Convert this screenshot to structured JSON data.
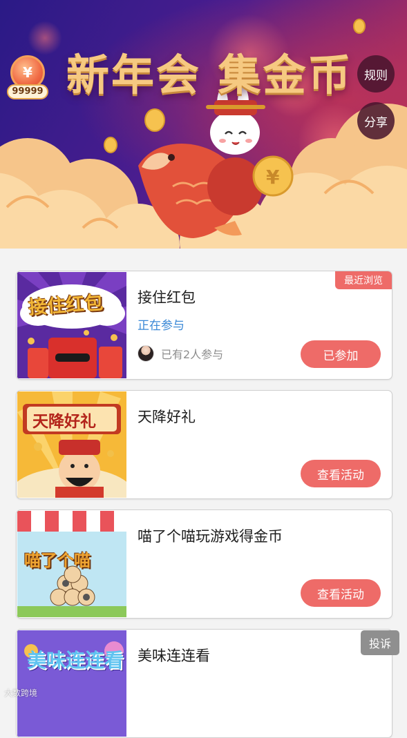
{
  "banner": {
    "title": "新年会 集金币",
    "coin_count": "99999",
    "coin_symbol": "¥",
    "rules_label": "规则",
    "share_label": "分享"
  },
  "activities": [
    {
      "title": "接住红包",
      "thumb_text": "接住红包",
      "status": "正在参与",
      "participants": "已有2人参与",
      "button": "已参加",
      "tag": "最近浏览"
    },
    {
      "title": "天降好礼",
      "thumb_text": "天降好礼",
      "button": "查看活动"
    },
    {
      "title": "喵了个喵玩游戏得金币",
      "thumb_text": "喵了个喵",
      "button": "查看活动"
    },
    {
      "title": "美味连连看",
      "thumb_text": "美味连连看"
    }
  ],
  "complain_label": "投诉",
  "watermark": "大数跨境",
  "colors": {
    "accent": "#ee6b68",
    "status_blue": "#3a88d6",
    "banner_gold": "#f6c981"
  }
}
